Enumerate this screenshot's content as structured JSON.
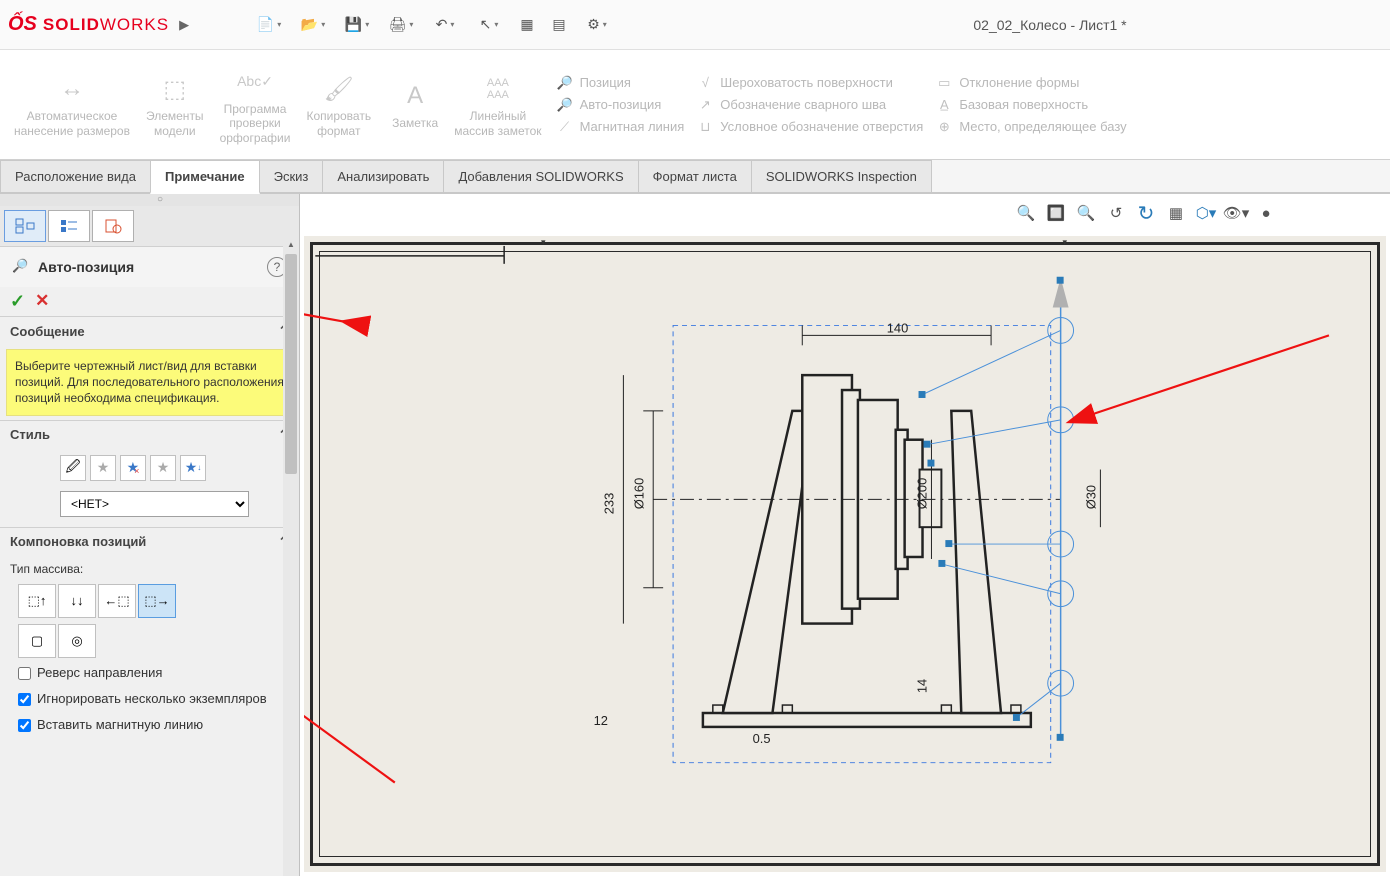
{
  "titlebar": {
    "brand_prefix": "DS",
    "brand_solid": "SOLID",
    "brand_works": "WORKS",
    "doc_title": "02_02_Колесо - Лист1 *"
  },
  "ribbon": {
    "auto_dim": "Автоматическое\nнанесение размеров",
    "model_items": "Элементы\nмодели",
    "spell_check": "Программа\nпроверки\nорфографии",
    "copy_format": "Копировать\nформат",
    "note": "Заметка",
    "linear_pattern": "Линейный\nмассив заметок",
    "balloon": "Позиция",
    "auto_balloon": "Авто-позиция",
    "magnetic_line": "Магнитная линия",
    "surface_finish": "Шероховатость поверхности",
    "weld_symbol": "Обозначение сварного шва",
    "hole_callout": "Условное обозначение отверстия",
    "geo_tol": "Отклонение формы",
    "datum_feature": "Базовая поверхность",
    "datum_target": "Место, определяющее базу"
  },
  "tabs": {
    "t1": "Расположение вида",
    "t2": "Примечание",
    "t3": "Эскиз",
    "t4": "Анализировать",
    "t5": "Добавления SOLIDWORKS",
    "t6": "Формат листа",
    "t7": "SOLIDWORKS Inspection"
  },
  "pm": {
    "title": "Авто-позиция",
    "section_msg": "Сообщение",
    "msg_body": "Выберите чертежный лист/вид для вставки позиций. Для последовательного расположения позиций необходима спецификация.",
    "section_style": "Стиль",
    "style_none": "<НЕТ>",
    "section_layout": "Компоновка позиций",
    "pattern_type": "Тип массива:",
    "reverse_dir": "Реверс направления",
    "ignore_multi": "Игнорировать несколько экземпляров",
    "insert_magnetic": "Вставить магнитную линию"
  },
  "drawing": {
    "dim_140": "140",
    "dim_160": "Ø160",
    "dim_233": "233",
    "dim_30": "Ø30",
    "dim_12": "12",
    "dim_14": "14",
    "dim_05": "0.5",
    "dim_200": "Ø200"
  }
}
